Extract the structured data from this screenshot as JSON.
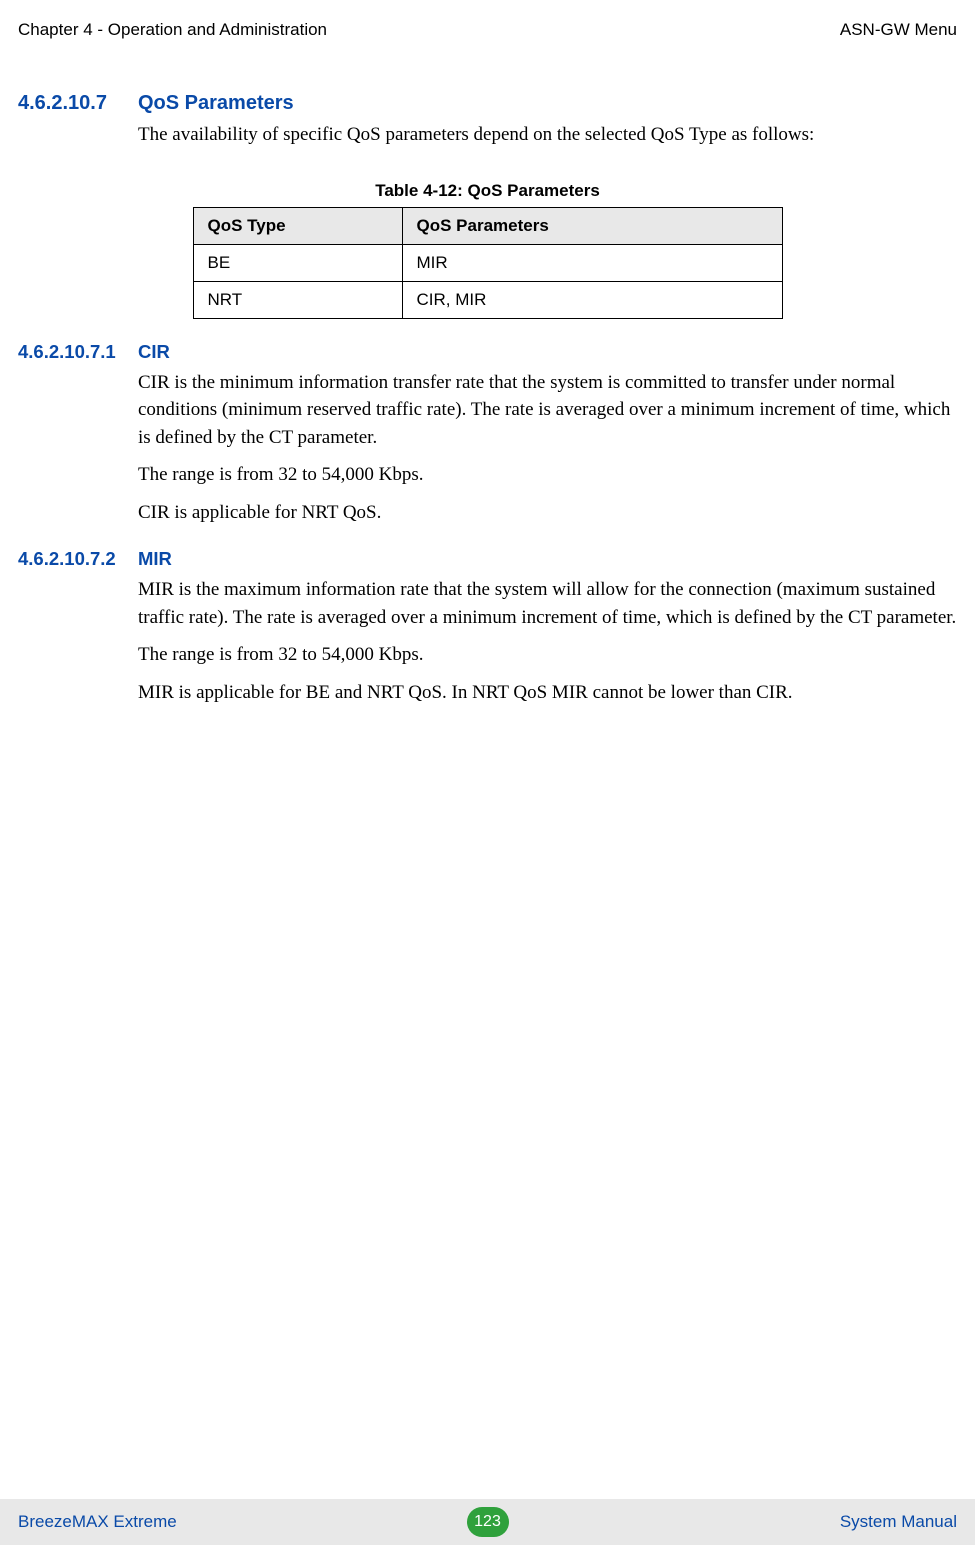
{
  "header": {
    "left": "Chapter 4 - Operation and Administration",
    "right": "ASN-GW Menu"
  },
  "sections": {
    "qos_params": {
      "num": "4.6.2.10.7",
      "title": "QoS Parameters",
      "intro": "The availability of specific QoS parameters depend on the selected QoS Type as follows:"
    },
    "cir": {
      "num": "4.6.2.10.7.1",
      "title": "CIR",
      "p1": "CIR is the minimum information transfer rate that the system is committed to transfer under normal conditions (minimum reserved traffic rate). The rate is averaged over a minimum increment of time, which is defined by the CT parameter.",
      "p2": "The range is from 32 to 54,000 Kbps.",
      "p3": "CIR is applicable for NRT QoS."
    },
    "mir": {
      "num": "4.6.2.10.7.2",
      "title": "MIR",
      "p1": "MIR is the maximum information rate that the system will allow for the connection (maximum sustained traffic rate). The rate is averaged over a minimum increment of time, which is defined by the CT parameter.",
      "p2": "The range is from 32 to 54,000 Kbps.",
      "p3": "MIR is applicable for BE and NRT QoS. In NRT QoS MIR cannot be lower than CIR."
    }
  },
  "table": {
    "caption": "Table 4-12: QoS Parameters",
    "headers": {
      "c0": "QoS Type",
      "c1": "QoS Parameters"
    },
    "rows": [
      {
        "c0": "BE",
        "c1": "MIR"
      },
      {
        "c0": "NRT",
        "c1": "CIR, MIR"
      }
    ]
  },
  "footer": {
    "left": "BreezeMAX Extreme",
    "page": "123",
    "right": "System Manual"
  }
}
